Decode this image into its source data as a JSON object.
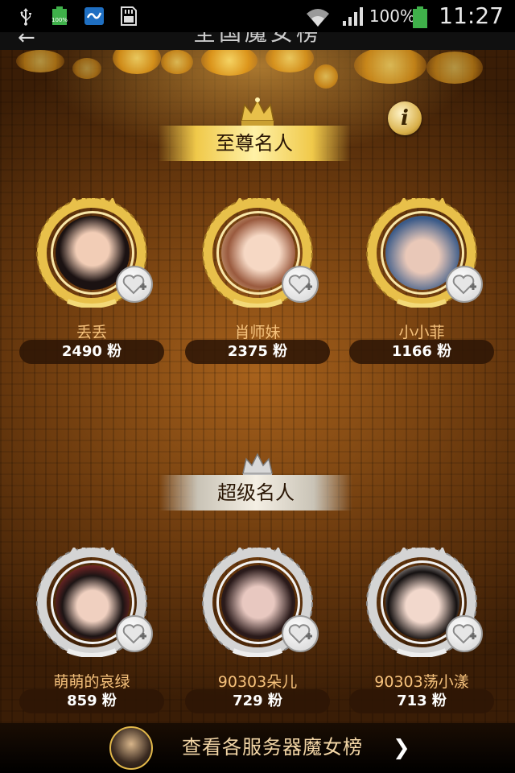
{
  "status_bar": {
    "battery_percent": "100%",
    "time": "11:27",
    "small_battery_label": "100%",
    "icons": [
      "usb-icon",
      "battery-full-icon",
      "app-notification-icon",
      "sd-card-icon",
      "wifi-icon",
      "signal-icon",
      "battery-icon"
    ]
  },
  "title_bar": {
    "back_icon": "back-arrow-icon",
    "title": "全国魔女榜"
  },
  "info_button": {
    "icon": "info-icon",
    "label": "i"
  },
  "sections": [
    {
      "title": "至尊名人",
      "tier": "gold",
      "items": [
        {
          "name": "丢丢",
          "fans": "2490 粉"
        },
        {
          "name": "肖师妹",
          "fans": "2375 粉"
        },
        {
          "name": "小小菲",
          "fans": "1166 粉"
        }
      ]
    },
    {
      "title": "超级名人",
      "tier": "silver",
      "items": [
        {
          "name": "萌萌的哀绿",
          "fans": "859 粉"
        },
        {
          "name": "90303朵儿",
          "fans": "729 粉"
        },
        {
          "name": "90303荡小漾",
          "fans": "713 粉"
        }
      ]
    }
  ],
  "bottom_bar": {
    "label": "查看各服务器魔女榜",
    "arrow_icon": "chevron-right-icon"
  },
  "colors": {
    "gold": "#e8c04a",
    "silver": "#d8d8d8",
    "name_text": "#f6c27c",
    "fans_pill": "#2d1606"
  }
}
